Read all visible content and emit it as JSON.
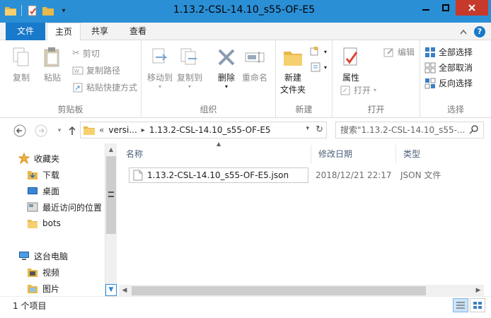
{
  "window": {
    "title": "1.13.2-CSL-14.10_s55-OF-E5"
  },
  "ribbon_tabs": {
    "file": "文件",
    "home": "主页",
    "share": "共享",
    "view": "查看"
  },
  "clipboard": {
    "label": "剪贴板",
    "copy": "复制",
    "paste": "粘贴",
    "cut": "剪切",
    "copy_path": "复制路径",
    "paste_shortcut": "粘贴快捷方式"
  },
  "organize": {
    "label": "组织",
    "move_to": "移动到",
    "copy_to": "复制到",
    "delete": "删除",
    "rename": "重命名"
  },
  "new_group": {
    "label": "新建",
    "new_folder_line1": "新建",
    "new_folder_line2": "文件夹"
  },
  "open_group": {
    "label": "打开",
    "properties": "属性",
    "open": "打开",
    "edit": "编辑"
  },
  "select_group": {
    "label": "选择",
    "select_all": "全部选择",
    "select_none": "全部取消",
    "invert": "反向选择"
  },
  "address": {
    "overflow": "«",
    "crumb1": "versi...",
    "crumb2": "1.13.2-CSL-14.10_s55-OF-E5"
  },
  "search": {
    "placeholder": "搜索\"1.13.2-CSL-14.10_s55-..."
  },
  "nav": {
    "favorites": "收藏夹",
    "downloads": "下载",
    "desktop": "桌面",
    "recent": "最近访问的位置",
    "bots": "bots",
    "this_pc": "这台电脑",
    "videos": "视频",
    "pictures": "图片"
  },
  "columns": {
    "name": "名称",
    "date": "修改日期",
    "type": "类型"
  },
  "files": [
    {
      "name": "1.13.2-CSL-14.10_s55-OF-E5.json",
      "date": "2018/12/21 22:17",
      "type": "JSON 文件"
    }
  ],
  "status": {
    "count": "1 个项目"
  },
  "colors": {
    "accent": "#1979ca",
    "titlebar": "#2b8fd6",
    "close": "#c7392b",
    "folder": "#e8b84a"
  },
  "icons": [
    "folder-icon",
    "star-icon",
    "monitor-icon",
    "file-icon",
    "search-icon",
    "refresh-icon"
  ]
}
